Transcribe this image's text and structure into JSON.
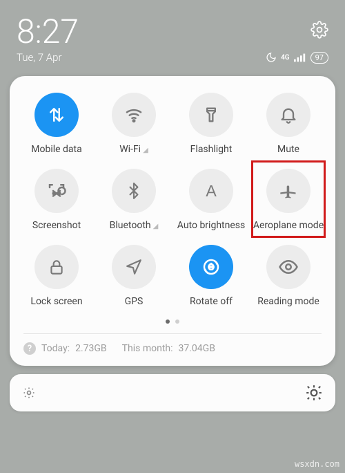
{
  "status": {
    "time": "8:27",
    "date": "Tue, 7 Apr",
    "network_type": "4G",
    "battery": "97"
  },
  "tiles": [
    {
      "label": "Mobile data",
      "active": true,
      "icon": "data",
      "indicator": false
    },
    {
      "label": "Wi-Fi",
      "active": false,
      "icon": "wifi",
      "indicator": true
    },
    {
      "label": "Flashlight",
      "active": false,
      "icon": "flashlight",
      "indicator": false
    },
    {
      "label": "Mute",
      "active": false,
      "icon": "bell",
      "indicator": false
    },
    {
      "label": "Screenshot",
      "active": false,
      "icon": "screenshot",
      "indicator": false
    },
    {
      "label": "Bluetooth",
      "active": false,
      "icon": "bluetooth",
      "indicator": true
    },
    {
      "label": "Auto brightness",
      "active": false,
      "icon": "letter-a",
      "indicator": false
    },
    {
      "label": "Aeroplane mode",
      "active": false,
      "icon": "airplane",
      "indicator": false,
      "highlight": true
    },
    {
      "label": "Lock screen",
      "active": false,
      "icon": "lock",
      "indicator": false
    },
    {
      "label": "GPS",
      "active": false,
      "icon": "location",
      "indicator": false
    },
    {
      "label": "Rotate off",
      "active": true,
      "icon": "rotate",
      "indicator": false
    },
    {
      "label": "Reading mode",
      "active": false,
      "icon": "eye",
      "indicator": false
    }
  ],
  "usage": {
    "today_label": "Today:",
    "today_value": "2.73GB",
    "month_label": "This month:",
    "month_value": "37.04GB"
  },
  "watermark": "wsxdn.com"
}
